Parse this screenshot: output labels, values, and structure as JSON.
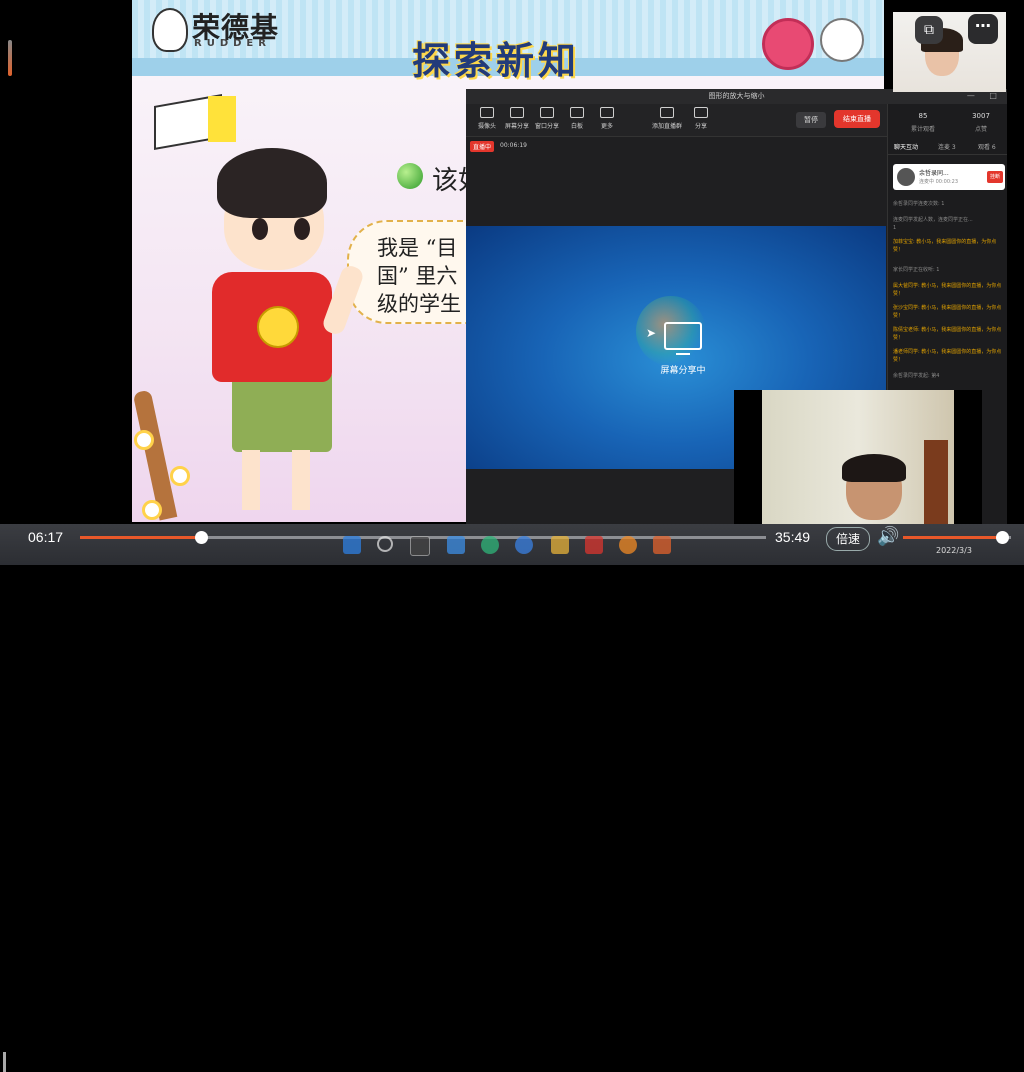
{
  "slide": {
    "brand_cn": "荣德基",
    "brand_en": "RUDDER",
    "title": "探索新知",
    "line1": "该如",
    "bubble_line1": "我是 “目",
    "bubble_line2": "国” 里六",
    "bubble_line3": "级的学生"
  },
  "share_window": {
    "title": "图形的放大与缩小",
    "toolbar": [
      {
        "icon": "camera-icon",
        "label": "摄像头"
      },
      {
        "icon": "screen-share-icon",
        "label": "屏幕分享"
      },
      {
        "icon": "window-share-icon",
        "label": "窗口分享"
      },
      {
        "icon": "whiteboard-icon",
        "label": "白板"
      },
      {
        "icon": "more-icon",
        "label": "更多"
      },
      {
        "icon": "add-member-icon",
        "label": "添加直播群"
      },
      {
        "icon": "share-icon",
        "label": "分享"
      }
    ],
    "pause_label": "暂停",
    "end_label": "结束直播",
    "live_badge": "直播中",
    "live_time": "00:06:19",
    "screen_share_label": "屏幕分享中"
  },
  "side_panel": {
    "stats": [
      {
        "value": "85",
        "label": "累计观看"
      },
      {
        "value": "3007",
        "label": "点赞"
      }
    ],
    "tabs": [
      "聊天互动",
      "连麦 3",
      "观看 6"
    ],
    "user_name": "余哲录同...",
    "user_sub": "连麦中 00:00:23",
    "user_button": "挂断",
    "chat": [
      {
        "text": "余哲录同学连麦次数: 1",
        "hl": false
      },
      {
        "text": "连麦同学发起人数，连麦同学正在...",
        "hl": false
      },
      {
        "text": "1",
        "hl": false
      },
      {
        "text": "加菲宝宝: 教小马，我来圆圆你的直播，为你点赞！",
        "hl": true
      },
      {
        "text": "家长同学正在收听: 1",
        "hl": false
      },
      {
        "text": "属大爸同学: 教小马，我来圆圆你的直播，为你点赞！",
        "hl": true
      },
      {
        "text": "张沙宝同学: 教小马，我来圆圆你的直播，为你点赞！",
        "hl": true
      },
      {
        "text": "陈倩宝老师: 教小马，我来圆圆你的直播，为你点赞！",
        "hl": true
      },
      {
        "text": "潘老师同学: 教小马，我来圆圆你的直播，为你点赞！",
        "hl": true
      },
      {
        "text": "余哲录同学发起: 第4",
        "hl": false
      }
    ]
  },
  "player": {
    "current_time": "06:17",
    "total_time": "35:49",
    "progress_fraction": 0.176,
    "speed_label": "倍速",
    "volume_fraction": 0.92,
    "date": "2022/3/3"
  },
  "taskbar_icons": [
    "windows-start-icon",
    "search-icon",
    "task-view-icon",
    "widgets-icon",
    "edge-icon",
    "browser-icon",
    "file-explorer-icon",
    "wps-icon",
    "live-app-icon",
    "media-icon"
  ]
}
